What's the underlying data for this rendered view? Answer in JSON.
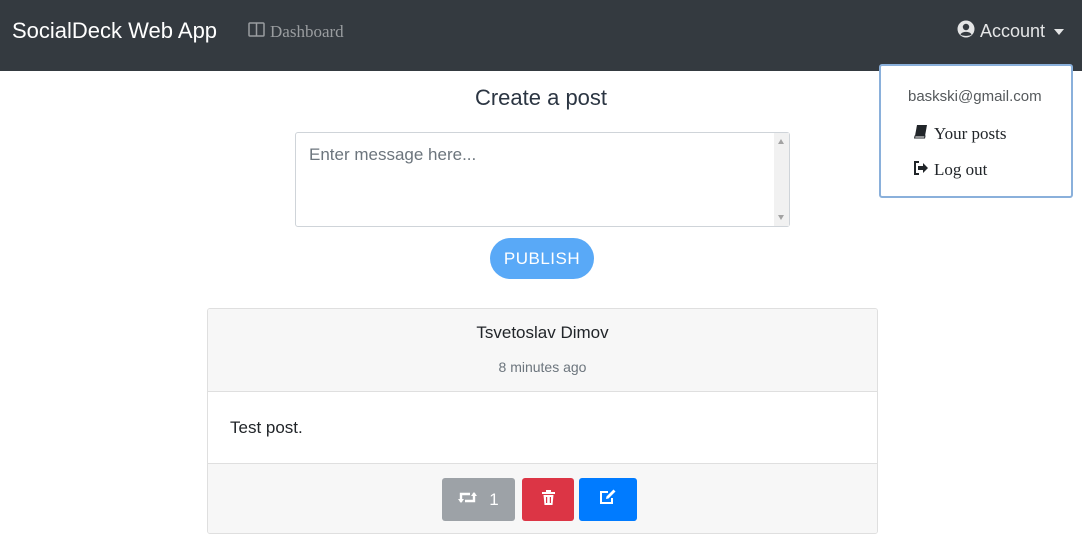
{
  "navbar": {
    "brand": "SocialDeck Web App",
    "dashboard_label": "Dashboard",
    "dashboard_icon": "columns-icon",
    "account_label": "Account",
    "account_icon": "user-circle-icon",
    "background": "#343a40"
  },
  "account_menu": {
    "email": "baskski@gmail.com",
    "items": [
      {
        "label": "Your posts",
        "icon": "book-icon"
      },
      {
        "label": "Log out",
        "icon": "sign-out-icon"
      }
    ]
  },
  "create_post": {
    "title": "Create a post",
    "message_placeholder": "Enter message here...",
    "message_value": "",
    "publish_label": "PUBLISH",
    "publish_color": "#59a9f7"
  },
  "posts": [
    {
      "author": "Tsvetoslav Dimov",
      "time": "8 minutes ago",
      "content": "Test post.",
      "repost_count": "1",
      "actions": [
        {
          "name": "repost",
          "icon": "retweet-icon",
          "color": "#9da2a7"
        },
        {
          "name": "delete",
          "icon": "trash-icon",
          "color": "#dc3545"
        },
        {
          "name": "edit",
          "icon": "edit-icon",
          "color": "#007bff"
        }
      ]
    }
  ]
}
